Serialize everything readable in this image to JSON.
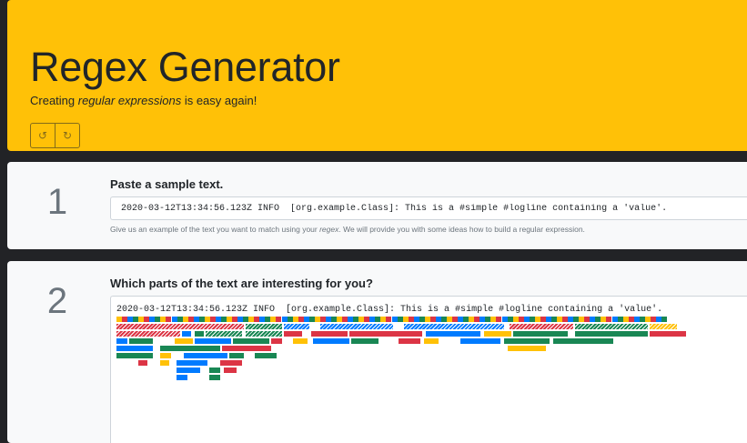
{
  "header": {
    "title": "Regex Generator",
    "lead_before": "Creating ",
    "lead_em": "regular expressions",
    "lead_after": " is easy again!",
    "undo_icon": "undo-icon",
    "redo_icon": "redo-icon"
  },
  "step1": {
    "number": "1",
    "title": "Paste a sample text.",
    "input_value": "2020-03-12T13:34:56.123Z INFO  [org.example.Class]: This is a #simple #logline containing a 'value'.",
    "help_before": "Give us an example of the text you want to match using your ",
    "help_em": "regex",
    "help_after": ". We will provide you with some ideas how to build a regular expression."
  },
  "step2": {
    "number": "2",
    "title": "Which parts of the text are interesting for you?",
    "sample_line": "2020-03-12T13:34:56.123Z INFO  [org.example.Class]: This is a #simple #logline containing a 'value'."
  },
  "colors": {
    "yellow": "#ffc107",
    "red": "#dc3545",
    "blue": "#007bff",
    "green": "#198754"
  }
}
